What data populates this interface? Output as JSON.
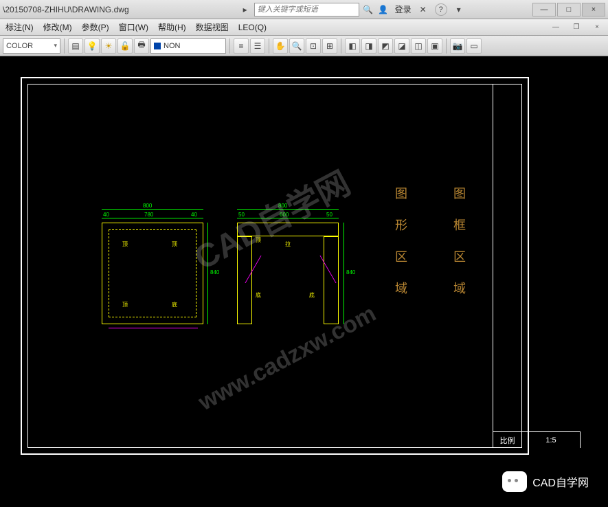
{
  "titlebar": {
    "file_path": "\\20150708-ZHIHU\\DRAWING.dwg",
    "search_placeholder": "键入关键字或短语",
    "login_label": "登录",
    "minimize": "—",
    "maximize": "□",
    "close": "×"
  },
  "menu": {
    "items": [
      "标注(N)",
      "修改(M)",
      "参数(P)",
      "窗口(W)",
      "帮助(H)",
      "数据视图",
      "LEO(Q)"
    ]
  },
  "toolbar": {
    "dropdown1": "COLOR",
    "layer_name": "NON"
  },
  "drawing": {
    "left_view": {
      "top_dim": "800",
      "sub_dims": [
        "40",
        "780",
        "40"
      ],
      "side_dim": "840",
      "tags": [
        "顶",
        "顶",
        "顶",
        "底"
      ]
    },
    "right_view": {
      "top_dim": "800",
      "sub_dims": [
        "50",
        "600",
        "50"
      ],
      "side_dim": "840",
      "tags": [
        "顶",
        "拉",
        "底",
        "底"
      ]
    },
    "titleblock": {
      "scale_label": "比例",
      "scale_value": "1:5"
    },
    "vlabels": {
      "left": "图形区域",
      "right": "图框区域"
    }
  },
  "watermarks": {
    "main": "CAD自学网",
    "url": "www.cadzxw.com"
  },
  "wechat": {
    "label": "CAD自学网"
  }
}
